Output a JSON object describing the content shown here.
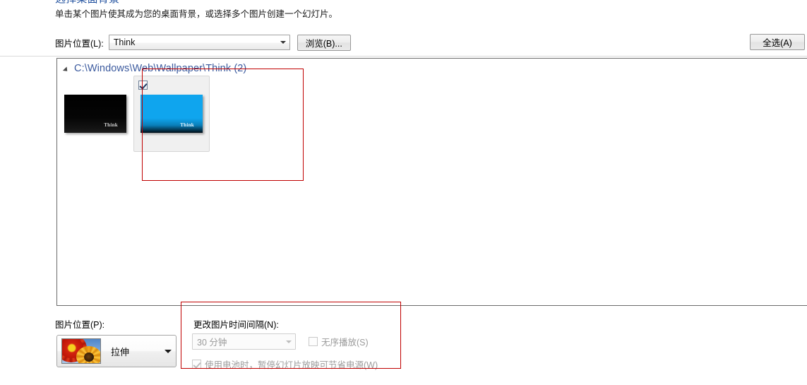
{
  "header": {
    "title": "选择桌面背景",
    "description": "单击某个图片使其成为您的桌面背景，或选择多个图片创建一个幻灯片。"
  },
  "toolbar": {
    "location_label": "图片位置(L):",
    "location_value": "Think",
    "browse_label": "浏览(B)...",
    "select_all_label": "全选(A)"
  },
  "list": {
    "group_header": "C:\\Windows\\Web\\Wallpaper\\Think (2)",
    "expander_icon": "triangle-down-icon",
    "items": [
      {
        "name": "think-black-wallpaper",
        "logo_text": "Think",
        "selected": false,
        "style": "black-think"
      },
      {
        "name": "think-blue-wallpaper",
        "logo_text": "Think",
        "selected": true,
        "style": "blue-think"
      }
    ]
  },
  "position": {
    "label": "图片位置(P):",
    "value": "拉伸",
    "thumb_icon": "flowers-thumbnail-icon",
    "arrow_icon": "chevron-down-icon"
  },
  "interval": {
    "label": "更改图片时间间隔(N):",
    "value": "30 分钟",
    "arrow_icon": "chevron-down-icon",
    "shuffle_label": "无序播放(S)",
    "shuffle_checked": false,
    "battery_label": "使用电池时，暂停幻灯片放映可节省电源(W)",
    "battery_checked": true
  },
  "colors": {
    "title_blue": "#20509e",
    "group_header_blue": "#3b5a9e",
    "annotation_red": "#c00000",
    "wallpaper_blue": "#0fa5ee",
    "disabled_text": "#9b9b9b"
  }
}
